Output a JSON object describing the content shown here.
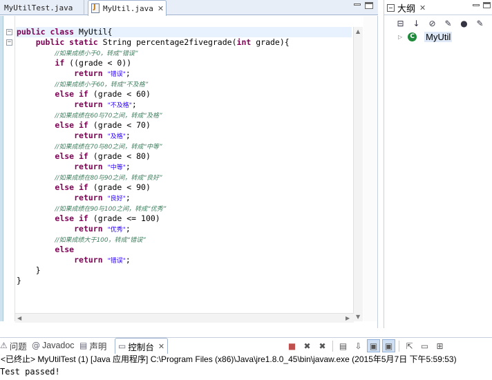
{
  "editor": {
    "tabs": [
      {
        "label": "MyUtilTest.java",
        "active": false
      },
      {
        "label": "MyUtil.java",
        "active": true,
        "close": "✕"
      }
    ],
    "code": [
      [
        [
          "kw",
          "public class "
        ],
        [
          "pl",
          "MyUtil{"
        ]
      ],
      [
        [
          "pl",
          "    "
        ],
        [
          "kw",
          "public static "
        ],
        [
          "pl",
          "String percentage2fivegrade("
        ],
        [
          "kw",
          "int "
        ],
        [
          "pl",
          "grade){"
        ]
      ],
      [
        [
          "pl",
          "        "
        ],
        [
          "cm",
          "//如果成绩小于0，转成“错误”"
        ]
      ],
      [
        [
          "pl",
          "        "
        ],
        [
          "kw",
          "if "
        ],
        [
          "pl",
          "((grade < 0))"
        ]
      ],
      [
        [
          "pl",
          "            "
        ],
        [
          "kw",
          "return "
        ],
        [
          "st",
          "\"错误\""
        ],
        [
          "pl",
          ";"
        ]
      ],
      [
        [
          "pl",
          "        "
        ],
        [
          "cm",
          "//如果成绩小于60，转成“不及格”"
        ]
      ],
      [
        [
          "pl",
          "        "
        ],
        [
          "kw",
          "else if "
        ],
        [
          "pl",
          "(grade < 60)"
        ]
      ],
      [
        [
          "pl",
          "            "
        ],
        [
          "kw",
          "return "
        ],
        [
          "st",
          "\"不及格\""
        ],
        [
          "pl",
          ";"
        ]
      ],
      [
        [
          "pl",
          "        "
        ],
        [
          "cm",
          "//如果成绩在60与70之间，转成“及格”"
        ]
      ],
      [
        [
          "pl",
          "        "
        ],
        [
          "kw",
          "else if "
        ],
        [
          "pl",
          "(grade < 70)"
        ]
      ],
      [
        [
          "pl",
          "            "
        ],
        [
          "kw",
          "return "
        ],
        [
          "st",
          "\"及格\""
        ],
        [
          "pl",
          ";"
        ]
      ],
      [
        [
          "pl",
          "        "
        ],
        [
          "cm",
          "//如果成绩在70与80之间，转成“中等”"
        ]
      ],
      [
        [
          "pl",
          "        "
        ],
        [
          "kw",
          "else if "
        ],
        [
          "pl",
          "(grade < 80)"
        ]
      ],
      [
        [
          "pl",
          "            "
        ],
        [
          "kw",
          "return "
        ],
        [
          "st",
          "\"中等\""
        ],
        [
          "pl",
          ";"
        ]
      ],
      [
        [
          "pl",
          "        "
        ],
        [
          "cm",
          "//如果成绩在80与90之间，转成“良好”"
        ]
      ],
      [
        [
          "pl",
          "        "
        ],
        [
          "kw",
          "else if "
        ],
        [
          "pl",
          "(grade < 90)"
        ]
      ],
      [
        [
          "pl",
          "            "
        ],
        [
          "kw",
          "return "
        ],
        [
          "st",
          "\"良好\""
        ],
        [
          "pl",
          ";"
        ]
      ],
      [
        [
          "pl",
          "        "
        ],
        [
          "cm",
          "//如果成绩在90与100之间，转成“优秀”"
        ]
      ],
      [
        [
          "pl",
          "        "
        ],
        [
          "kw",
          "else if "
        ],
        [
          "pl",
          "(grade <= 100)"
        ]
      ],
      [
        [
          "pl",
          "            "
        ],
        [
          "kw",
          "return "
        ],
        [
          "st",
          "\"优秀\""
        ],
        [
          "pl",
          ";"
        ]
      ],
      [
        [
          "pl",
          "        "
        ],
        [
          "cm",
          "//如果成绩大于100，转成“错误”"
        ]
      ],
      [
        [
          "pl",
          "        "
        ],
        [
          "kw",
          "else"
        ]
      ],
      [
        [
          "pl",
          "            "
        ],
        [
          "kw",
          "return "
        ],
        [
          "st",
          "\"错误\""
        ],
        [
          "pl",
          ";"
        ]
      ],
      [
        [
          "pl",
          "    }"
        ]
      ],
      [
        [
          "pl",
          "}"
        ]
      ]
    ]
  },
  "outline": {
    "tab_label": "大纲",
    "close": "✕",
    "class_name": "MyUtil",
    "class_icon": "C"
  },
  "bottom": {
    "tabs": {
      "problems": "问题",
      "javadoc": "Javadoc",
      "declaration": "声明",
      "console": "控制台"
    },
    "close": "✕"
  },
  "console": {
    "header": "<已终止> MyUtilTest (1) [Java 应用程序] C:\\Program Files (x86)\\Java\\jre1.8.0_45\\bin\\javaw.exe (2015年5月7日 下午5:59:53)",
    "output": "Test passed!"
  },
  "icons": {
    "editor": "java-file-icon",
    "outline": [
      "collapse-all-icon",
      "sort-az-icon",
      "hide-fields-icon",
      "hide-static-icon",
      "hide-nonpublic-icon",
      "hide-local-types-icon",
      "view-menu-icon"
    ]
  }
}
